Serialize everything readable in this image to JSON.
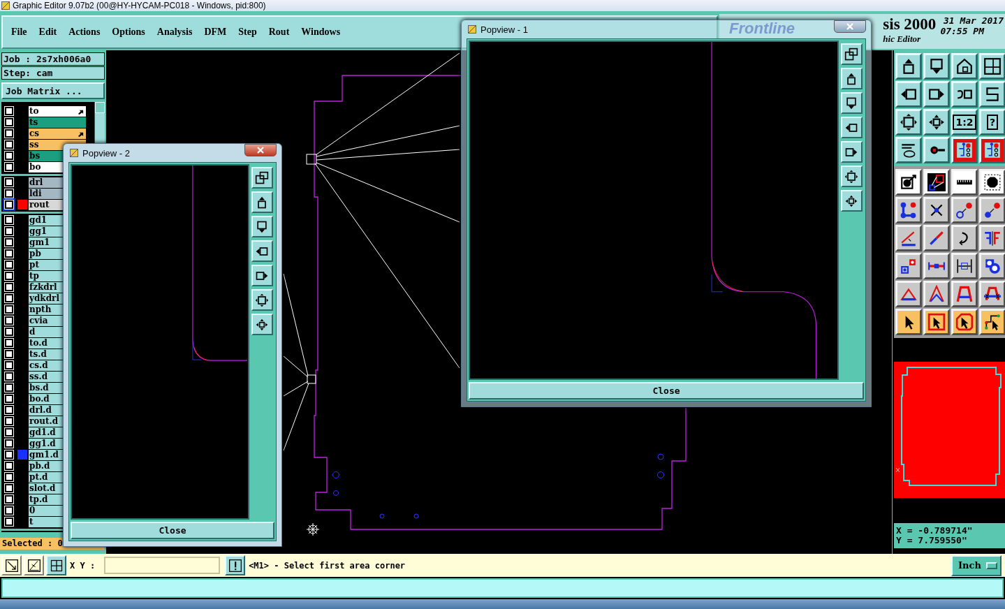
{
  "window": {
    "title": "Graphic Editor 9.07b2 (00@HY-HYCAM-PC018 - Windows, pid:800)"
  },
  "menu": [
    "File",
    "Edit",
    "Actions",
    "Options",
    "Analysis",
    "DFM",
    "Step",
    "Rout",
    "Windows"
  ],
  "header": {
    "logo": "Frontline",
    "product": "sis 2000",
    "subtitle": "hic Editor",
    "date": "31 Mar 2017",
    "time": "07:55 PM"
  },
  "job": {
    "job": "Job : 2s7xh006a0",
    "step": "Step: cam",
    "matrix_button": "Job Matrix ..."
  },
  "layer_groups": [
    {
      "layers": [
        {
          "name": "to",
          "color": "#ffffff",
          "checked": false,
          "arrow": true
        },
        {
          "name": "ts",
          "color": "#1a9f80",
          "checked": false,
          "arrow": false
        },
        {
          "name": "cs",
          "color": "#f8c060",
          "checked": false,
          "arrow": true
        },
        {
          "name": "ss",
          "color": "#f8c060",
          "checked": false,
          "arrow": false
        },
        {
          "name": "bs",
          "color": "#1a9f80",
          "checked": false,
          "arrow": false
        },
        {
          "name": "bo",
          "color": "#ffffff",
          "checked": false,
          "arrow": false
        }
      ]
    },
    {
      "layers": [
        {
          "name": "drl",
          "color": "#a4b8c4",
          "checked": false,
          "arrow": false
        },
        {
          "name": "ldi",
          "color": "#a4b8c4",
          "checked": false,
          "arrow": false
        },
        {
          "name": "rout",
          "color": "#d8d8d8",
          "checked": false,
          "arrow": false,
          "active": true,
          "swatch": {
            "color": "#ff0000"
          }
        }
      ]
    },
    {
      "layers": [
        {
          "name": "gd1",
          "color": "#a0dcdc",
          "checked": false,
          "arrow": false
        },
        {
          "name": "gg1",
          "color": "#a0dcdc",
          "checked": false,
          "arrow": false
        },
        {
          "name": "gm1",
          "color": "#a0dcdc",
          "checked": false,
          "arrow": false
        },
        {
          "name": "pb",
          "color": "#a0dcdc",
          "checked": false,
          "arrow": false
        },
        {
          "name": "pt",
          "color": "#a0dcdc",
          "checked": false,
          "arrow": false
        },
        {
          "name": "tp",
          "color": "#a0dcdc",
          "checked": false,
          "arrow": false
        },
        {
          "name": "fzkdrl",
          "color": "#a0dcdc",
          "checked": false,
          "arrow": false
        },
        {
          "name": "ydkdrl",
          "color": "#a0dcdc",
          "checked": false,
          "arrow": false
        },
        {
          "name": "npth",
          "color": "#a0dcdc",
          "checked": false,
          "arrow": false
        },
        {
          "name": "cvia",
          "color": "#a0dcdc",
          "checked": false,
          "arrow": false
        },
        {
          "name": "d",
          "color": "#a0dcdc",
          "checked": false,
          "arrow": false
        },
        {
          "name": "to.d",
          "color": "#a0dcdc",
          "checked": false,
          "arrow": false
        },
        {
          "name": "ts.d",
          "color": "#a0dcdc",
          "checked": false,
          "arrow": false
        },
        {
          "name": "cs.d",
          "color": "#a0dcdc",
          "checked": false,
          "arrow": false
        },
        {
          "name": "ss.d",
          "color": "#a0dcdc",
          "checked": false,
          "arrow": false
        },
        {
          "name": "bs.d",
          "color": "#a0dcdc",
          "checked": false,
          "arrow": false
        },
        {
          "name": "bo.d",
          "color": "#a0dcdc",
          "checked": false,
          "arrow": false
        },
        {
          "name": "drl.d",
          "color": "#a0dcdc",
          "checked": false,
          "arrow": false
        },
        {
          "name": "rout.d",
          "color": "#a0dcdc",
          "checked": false,
          "arrow": false
        },
        {
          "name": "gd1.d",
          "color": "#a0dcdc",
          "checked": false,
          "arrow": false
        },
        {
          "name": "gg1.d",
          "color": "#a0dcdc",
          "checked": false,
          "arrow": false
        },
        {
          "name": "gm1.d",
          "color": "#a0dcdc",
          "checked": false,
          "arrow": false,
          "swatch": {
            "color": "#1a30ff"
          }
        },
        {
          "name": "pb.d",
          "color": "#a0dcdc",
          "checked": false,
          "arrow": false
        },
        {
          "name": "pt.d",
          "color": "#a0dcdc",
          "checked": false,
          "arrow": false
        },
        {
          "name": "slot.d",
          "color": "#a0dcdc",
          "checked": false,
          "arrow": false
        },
        {
          "name": "tp.d",
          "color": "#a0dcdc",
          "checked": false,
          "arrow": false
        },
        {
          "name": "0",
          "color": "#a0dcdc",
          "checked": false,
          "arrow": false
        },
        {
          "name": "t",
          "color": "#a0dcdc",
          "checked": false,
          "arrow": false
        }
      ]
    }
  ],
  "selected_count": "Selected : 0",
  "popviews": [
    {
      "title": "Popview - 2",
      "close": "Close",
      "kind": "small",
      "tools": [
        {
          "kind": "windows"
        },
        {
          "kind": "box-up"
        },
        {
          "kind": "box-down"
        },
        {
          "kind": "box-left"
        },
        {
          "kind": "box-right"
        },
        {
          "kind": "fit"
        },
        {
          "kind": "center"
        }
      ]
    },
    {
      "title": "Popview - 1",
      "close": "Close",
      "kind": "large",
      "tools": [
        {
          "kind": "windows"
        },
        {
          "kind": "box-up"
        },
        {
          "kind": "box-down"
        },
        {
          "kind": "box-left"
        },
        {
          "kind": "box-right"
        },
        {
          "kind": "fit"
        },
        {
          "kind": "center"
        }
      ]
    }
  ],
  "toolbar": [
    {
      "kind": "box-up",
      "on": false
    },
    {
      "kind": "box-down",
      "on": false
    },
    {
      "kind": "home",
      "on": false
    },
    {
      "kind": "grid",
      "on": false
    },
    {
      "kind": "box-left",
      "on": false
    },
    {
      "kind": "box-right",
      "on": false
    },
    {
      "kind": "undo",
      "on": false
    },
    {
      "kind": "s-curve",
      "on": false
    },
    {
      "kind": "fit",
      "on": false
    },
    {
      "kind": "center",
      "on": false
    },
    {
      "kind": "label",
      "label": "1:2",
      "on": false
    },
    {
      "kind": "label",
      "label": "?",
      "on": false
    },
    {
      "kind": "tools",
      "on": false
    },
    {
      "kind": "snap",
      "on": false
    },
    {
      "kind": "net",
      "on": true
    },
    {
      "kind": "net",
      "on": true
    },
    {
      "kind": "move",
      "on": false
    },
    {
      "kind": "cut-box",
      "on": false
    },
    {
      "kind": "ruler",
      "on": false
    },
    {
      "kind": "pad",
      "on": false
    },
    {
      "kind": "nodes",
      "on": false
    },
    {
      "kind": "cross",
      "on": false
    },
    {
      "kind": "circle-move",
      "on": false
    },
    {
      "kind": "dot-move",
      "on": false
    },
    {
      "kind": "angle-line",
      "on": false
    },
    {
      "kind": "slash",
      "on": false
    },
    {
      "kind": "rotate",
      "on": false
    },
    {
      "kind": "mirror",
      "on": false
    },
    {
      "kind": "pad-move",
      "on": false
    },
    {
      "kind": "line",
      "on": false
    },
    {
      "kind": "dim",
      "on": false
    },
    {
      "kind": "blob",
      "on": false
    },
    {
      "kind": "triangle",
      "on": false
    },
    {
      "kind": "peak",
      "on": false
    },
    {
      "kind": "arch",
      "on": false
    },
    {
      "kind": "arch-cross",
      "on": false
    },
    {
      "kind": "pointer",
      "on": false
    },
    {
      "kind": "pointer-box",
      "on": false
    },
    {
      "kind": "pointer-oct",
      "on": false
    },
    {
      "kind": "pointer-route",
      "on": false
    }
  ],
  "coordinates": {
    "x": "X = -0.789714\"",
    "y": "Y = 7.759550\""
  },
  "command_bar": {
    "xy_label": "X Y :",
    "message": "<M1> - Select first area corner",
    "units": "Inch"
  }
}
